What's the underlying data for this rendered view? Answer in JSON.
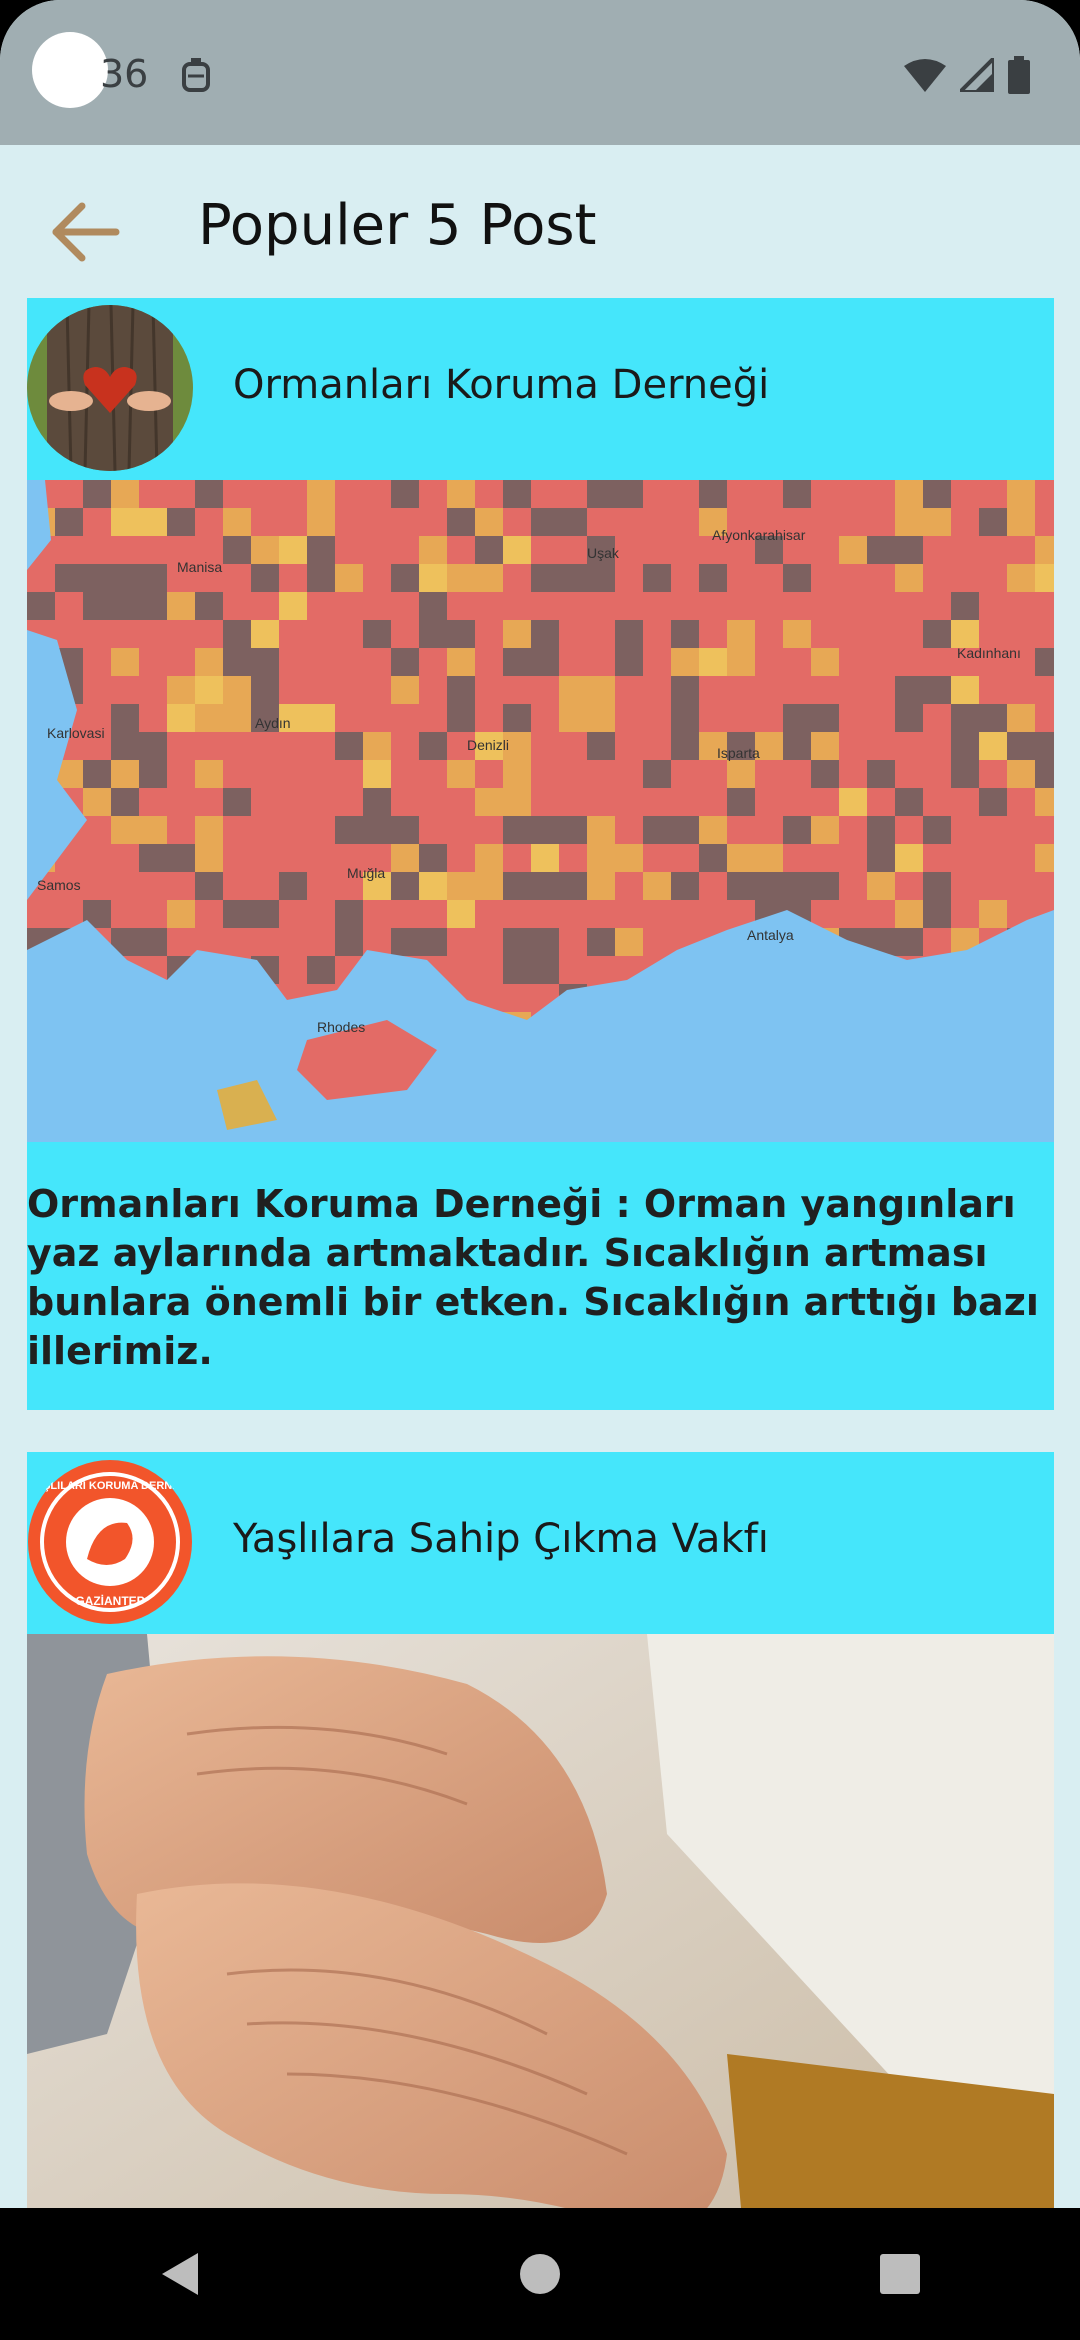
{
  "status_bar": {
    "time": "36",
    "icons": [
      "notification-icon",
      "wifi-icon",
      "signal-icon",
      "battery-icon"
    ]
  },
  "app_bar": {
    "title": "Populer 5 Post",
    "back_icon": "arrow-left-icon"
  },
  "posts": [
    {
      "organization": "Ormanları Koruma Derneği",
      "text": "Ormanları Koruma Derneği  :        Orman yangınları yaz aylarında artmaktadır. Sıcaklığın artması bunlara önemli bir etken. Sıcaklığın arttığı bazı illerimiz.",
      "image": "map-image",
      "map_labels": [
        "Manisa",
        "Afyonkarahisar",
        "Uşak",
        "Aydın",
        "Denizli",
        "Isparta",
        "Muğla",
        "Antalya",
        "Rhodes",
        "Karlovasi",
        "Samos",
        "Kadınhanı"
      ]
    },
    {
      "organization": "Yaşlılara Sahip Çıkma Vakfı",
      "logo_text": [
        "YAŞLILARI KORUMA DERNEĞİ",
        "GAZİANTEP"
      ],
      "image": "elderly-hands-image"
    }
  ],
  "colors": {
    "accent": "#45e6fb",
    "background": "#d9eef2",
    "status_bar": "#a0aeb2",
    "back_arrow": "#b08a5e"
  },
  "nav_bar": {
    "icons": [
      "back-triangle-icon",
      "home-circle-icon",
      "recents-square-icon"
    ]
  }
}
